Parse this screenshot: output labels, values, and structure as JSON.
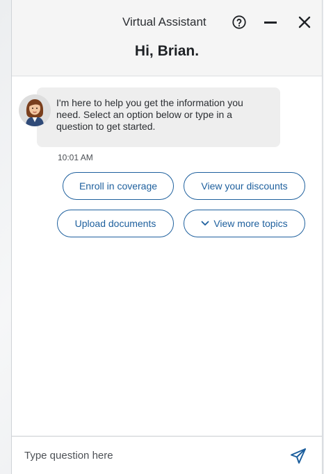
{
  "header": {
    "title": "Virtual Assistant",
    "greeting": "Hi, Brian.",
    "icons": {
      "help": "help-circle-icon",
      "minimize": "minimize-icon",
      "close": "close-icon"
    }
  },
  "conversation": {
    "assistant_avatar": "assistant-avatar",
    "message": "I'm here to help you get the information you need. Select an option below or type in a question to get started.",
    "timestamp": "10:01 AM"
  },
  "quick_replies": [
    {
      "label": "Enroll in coverage"
    },
    {
      "label": "View your discounts"
    },
    {
      "label": "Upload documents"
    },
    {
      "label": "View more topics",
      "icon": "chevron-down-icon"
    }
  ],
  "composer": {
    "placeholder": "Type question here",
    "send_icon": "send-icon"
  },
  "colors": {
    "accent": "#1d5f9d",
    "header_bg": "#f5f5f5",
    "bubble_bg": "#eeeeee"
  }
}
